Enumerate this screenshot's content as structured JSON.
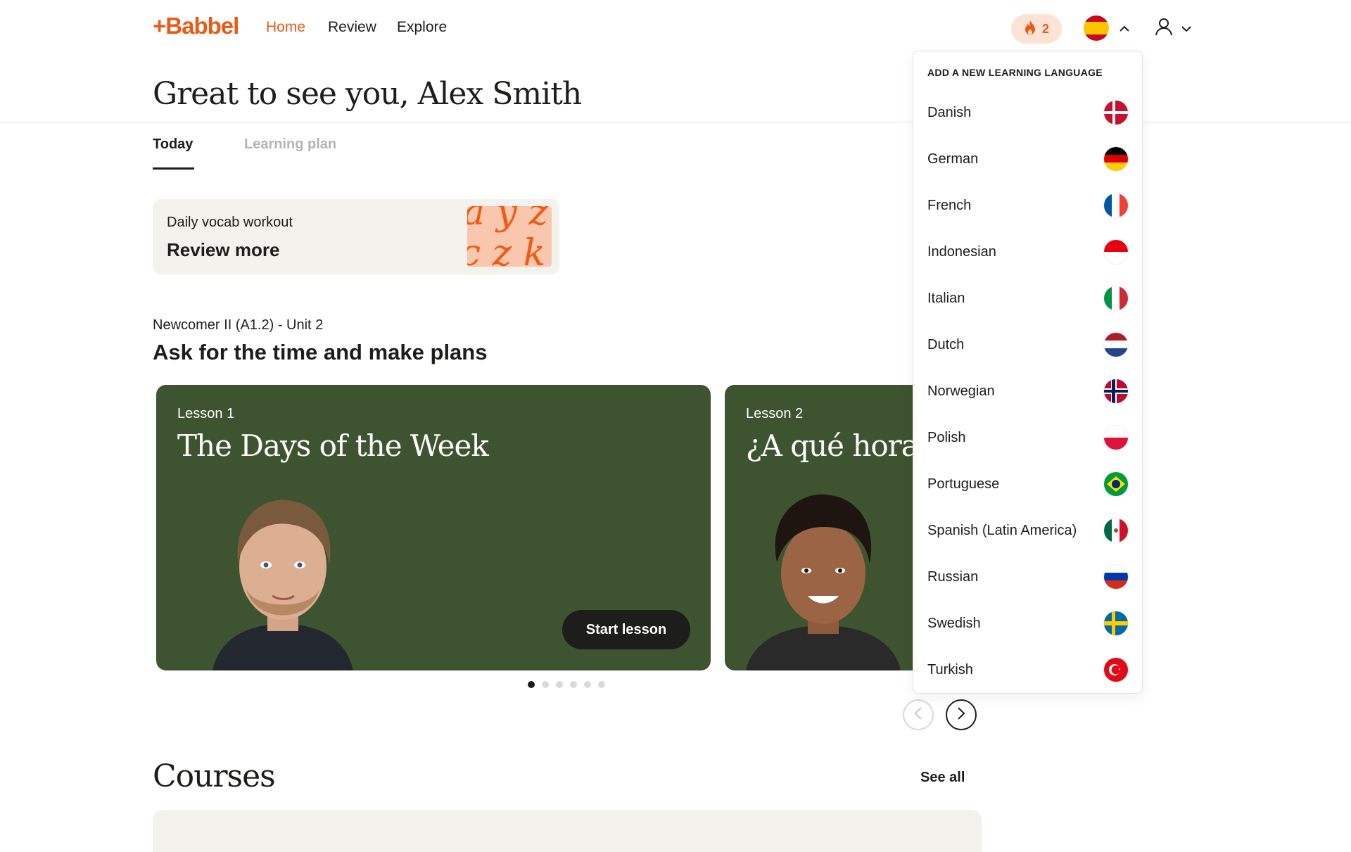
{
  "brand": {
    "logo_text": "+Babbel",
    "accent": "#ea5a15"
  },
  "nav": {
    "items": [
      {
        "label": "Home",
        "active": true
      },
      {
        "label": "Review"
      },
      {
        "label": "Explore"
      }
    ]
  },
  "header": {
    "streak_count": "2",
    "streak_icon": "flame-icon",
    "current_language_flag": "spain",
    "user_icon": "user-icon"
  },
  "greeting": "Great to see you, Alex Smith",
  "tabs": [
    {
      "label": "Today",
      "active": true
    },
    {
      "label": "Learning plan"
    }
  ],
  "vocab_card": {
    "subtitle": "Daily vocab workout",
    "action": "Review more"
  },
  "unit": {
    "label": "Newcomer II (A1.2) - Unit 2",
    "title": "Ask for the time and make plans"
  },
  "lessons": [
    {
      "number": "Lesson 1",
      "title": "The Days of the Week",
      "button": "Start lesson"
    },
    {
      "number": "Lesson 2",
      "title": "¿A qué hora q"
    }
  ],
  "carousel": {
    "page_count": 6,
    "active_index": 0
  },
  "courses": {
    "title": "Courses",
    "see_all": "See all"
  },
  "language_menu": {
    "heading": "ADD A NEW LEARNING LANGUAGE",
    "items": [
      {
        "label": "Danish",
        "flag": "denmark"
      },
      {
        "label": "German",
        "flag": "germany"
      },
      {
        "label": "French",
        "flag": "france"
      },
      {
        "label": "Indonesian",
        "flag": "indonesia"
      },
      {
        "label": "Italian",
        "flag": "italy"
      },
      {
        "label": "Dutch",
        "flag": "netherlands"
      },
      {
        "label": "Norwegian",
        "flag": "norway"
      },
      {
        "label": "Polish",
        "flag": "poland"
      },
      {
        "label": "Portuguese",
        "flag": "brazil"
      },
      {
        "label": "Spanish (Latin America)",
        "flag": "mexico"
      },
      {
        "label": "Russian",
        "flag": "russia"
      },
      {
        "label": "Swedish",
        "flag": "sweden"
      },
      {
        "label": "Turkish",
        "flag": "turkey"
      }
    ]
  }
}
